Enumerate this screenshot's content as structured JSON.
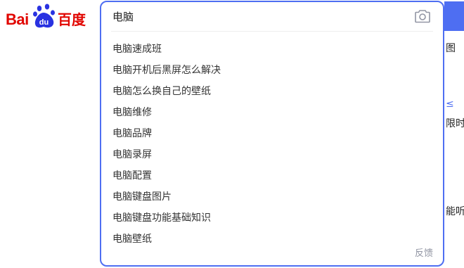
{
  "logo": {
    "left_text": "Bai",
    "paw_text": "du",
    "right_text": "百度",
    "color": "#e10601",
    "paw_color": "#2932e1"
  },
  "search": {
    "query": "电脑",
    "camera_icon": "camera-icon",
    "accent_color": "#4e6ef2"
  },
  "suggestions": [
    "电脑速成班",
    "电脑开机后黑屏怎么解决",
    "电脑怎么换自己的壁纸",
    "电脑维修",
    "电脑品牌",
    "电脑录屏",
    "电脑配置",
    "电脑键盘图片",
    "电脑键盘功能基础知识",
    "电脑壁纸"
  ],
  "feedback_label": "反馈",
  "background_fragments": {
    "frag1": "图",
    "frag2": "≤",
    "frag3": "限时",
    "frag4": "能听"
  }
}
